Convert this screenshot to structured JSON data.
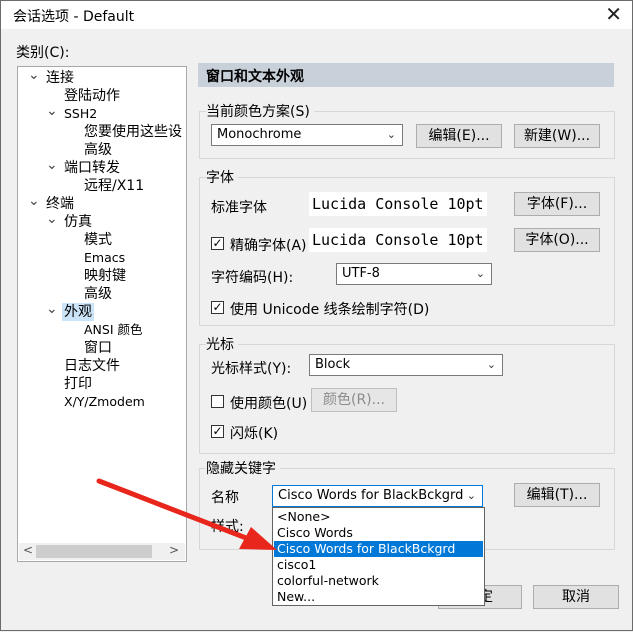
{
  "window": {
    "title": "会话选项 - Default",
    "close": "✕"
  },
  "category": {
    "label": "类别(C):",
    "tree": [
      {
        "label": "连接",
        "level": 0,
        "expand": "⌄"
      },
      {
        "label": "登陆动作",
        "level": 1
      },
      {
        "label": "SSH2",
        "level": 1,
        "expand": "⌄"
      },
      {
        "label": "您要使用这些设",
        "level": 2
      },
      {
        "label": "高级",
        "level": 2
      },
      {
        "label": "端口转发",
        "level": 1,
        "expand": "⌄"
      },
      {
        "label": "远程/X11",
        "level": 2
      },
      {
        "label": "终端",
        "level": 0,
        "expand": "⌄"
      },
      {
        "label": "仿真",
        "level": 1,
        "expand": "⌄"
      },
      {
        "label": "模式",
        "level": 2
      },
      {
        "label": "Emacs",
        "level": 2
      },
      {
        "label": "映射键",
        "level": 2
      },
      {
        "label": "高级",
        "level": 2
      },
      {
        "label": "外观",
        "level": 1,
        "expand": "⌄",
        "selected": true
      },
      {
        "label": "ANSI 颜色",
        "level": 2
      },
      {
        "label": "窗口",
        "level": 2
      },
      {
        "label": "日志文件",
        "level": 1
      },
      {
        "label": "打印",
        "level": 1
      },
      {
        "label": "X/Y/Zmodem",
        "level": 1
      }
    ],
    "scroll_left": "<",
    "scroll_right": ">"
  },
  "panel": {
    "header": "窗口和文本外观",
    "color_scheme": {
      "title": "当前颜色方案(S)",
      "value": "Monochrome",
      "edit": "编辑(E)...",
      "new": "新建(W)..."
    },
    "font": {
      "title": "字体",
      "normal_label": "标准字体",
      "normal_value": "Lucida Console 10pt",
      "normal_btn": "字体(F)...",
      "precise_label": "精确字体(A)",
      "precise_checked": true,
      "precise_value": "Lucida Console 10pt",
      "precise_btn": "字体(O)...",
      "encoding_label": "字符编码(H):",
      "encoding_value": "UTF-8",
      "unicode_label": "使用 Unicode 线条绘制字符(D)",
      "unicode_checked": true
    },
    "cursor": {
      "title": "光标",
      "style_label": "光标样式(Y):",
      "style_value": "Block",
      "color_label": "使用颜色(U)",
      "color_checked": false,
      "color_btn": "颜色(R)...",
      "blink_label": "闪烁(K)",
      "blink_checked": true
    },
    "keywords": {
      "title": "隐藏关键字",
      "name_label": "名称",
      "name_value": "Cisco Words for BlackBckgrd",
      "edit": "编辑(T)...",
      "style_label": "样式:",
      "options": [
        "<None>",
        "Cisco Words",
        "Cisco Words for BlackBckgrd",
        "cisco1",
        "colorful-network",
        "New..."
      ],
      "highlighted_index": 2
    }
  },
  "footer": {
    "ok": "定",
    "cancel": "取消"
  },
  "colors": {
    "annotation_arrow": "#e8261c",
    "selection": "#0078d7",
    "header_bg": "#c8d0d9"
  },
  "icons": {
    "dropdown": "chevron-down-icon",
    "check": "check-icon"
  }
}
